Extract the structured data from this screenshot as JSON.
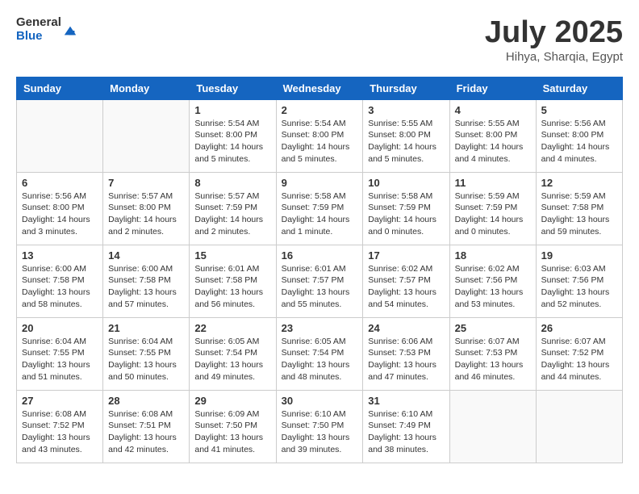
{
  "header": {
    "logo_general": "General",
    "logo_blue": "Blue",
    "month_title": "July 2025",
    "location": "Hihya, Sharqia, Egypt"
  },
  "days_of_week": [
    "Sunday",
    "Monday",
    "Tuesday",
    "Wednesday",
    "Thursday",
    "Friday",
    "Saturday"
  ],
  "weeks": [
    [
      {
        "num": "",
        "info": ""
      },
      {
        "num": "",
        "info": ""
      },
      {
        "num": "1",
        "info": "Sunrise: 5:54 AM\nSunset: 8:00 PM\nDaylight: 14 hours and 5 minutes."
      },
      {
        "num": "2",
        "info": "Sunrise: 5:54 AM\nSunset: 8:00 PM\nDaylight: 14 hours and 5 minutes."
      },
      {
        "num": "3",
        "info": "Sunrise: 5:55 AM\nSunset: 8:00 PM\nDaylight: 14 hours and 5 minutes."
      },
      {
        "num": "4",
        "info": "Sunrise: 5:55 AM\nSunset: 8:00 PM\nDaylight: 14 hours and 4 minutes."
      },
      {
        "num": "5",
        "info": "Sunrise: 5:56 AM\nSunset: 8:00 PM\nDaylight: 14 hours and 4 minutes."
      }
    ],
    [
      {
        "num": "6",
        "info": "Sunrise: 5:56 AM\nSunset: 8:00 PM\nDaylight: 14 hours and 3 minutes."
      },
      {
        "num": "7",
        "info": "Sunrise: 5:57 AM\nSunset: 8:00 PM\nDaylight: 14 hours and 2 minutes."
      },
      {
        "num": "8",
        "info": "Sunrise: 5:57 AM\nSunset: 7:59 PM\nDaylight: 14 hours and 2 minutes."
      },
      {
        "num": "9",
        "info": "Sunrise: 5:58 AM\nSunset: 7:59 PM\nDaylight: 14 hours and 1 minute."
      },
      {
        "num": "10",
        "info": "Sunrise: 5:58 AM\nSunset: 7:59 PM\nDaylight: 14 hours and 0 minutes."
      },
      {
        "num": "11",
        "info": "Sunrise: 5:59 AM\nSunset: 7:59 PM\nDaylight: 14 hours and 0 minutes."
      },
      {
        "num": "12",
        "info": "Sunrise: 5:59 AM\nSunset: 7:58 PM\nDaylight: 13 hours and 59 minutes."
      }
    ],
    [
      {
        "num": "13",
        "info": "Sunrise: 6:00 AM\nSunset: 7:58 PM\nDaylight: 13 hours and 58 minutes."
      },
      {
        "num": "14",
        "info": "Sunrise: 6:00 AM\nSunset: 7:58 PM\nDaylight: 13 hours and 57 minutes."
      },
      {
        "num": "15",
        "info": "Sunrise: 6:01 AM\nSunset: 7:58 PM\nDaylight: 13 hours and 56 minutes."
      },
      {
        "num": "16",
        "info": "Sunrise: 6:01 AM\nSunset: 7:57 PM\nDaylight: 13 hours and 55 minutes."
      },
      {
        "num": "17",
        "info": "Sunrise: 6:02 AM\nSunset: 7:57 PM\nDaylight: 13 hours and 54 minutes."
      },
      {
        "num": "18",
        "info": "Sunrise: 6:02 AM\nSunset: 7:56 PM\nDaylight: 13 hours and 53 minutes."
      },
      {
        "num": "19",
        "info": "Sunrise: 6:03 AM\nSunset: 7:56 PM\nDaylight: 13 hours and 52 minutes."
      }
    ],
    [
      {
        "num": "20",
        "info": "Sunrise: 6:04 AM\nSunset: 7:55 PM\nDaylight: 13 hours and 51 minutes."
      },
      {
        "num": "21",
        "info": "Sunrise: 6:04 AM\nSunset: 7:55 PM\nDaylight: 13 hours and 50 minutes."
      },
      {
        "num": "22",
        "info": "Sunrise: 6:05 AM\nSunset: 7:54 PM\nDaylight: 13 hours and 49 minutes."
      },
      {
        "num": "23",
        "info": "Sunrise: 6:05 AM\nSunset: 7:54 PM\nDaylight: 13 hours and 48 minutes."
      },
      {
        "num": "24",
        "info": "Sunrise: 6:06 AM\nSunset: 7:53 PM\nDaylight: 13 hours and 47 minutes."
      },
      {
        "num": "25",
        "info": "Sunrise: 6:07 AM\nSunset: 7:53 PM\nDaylight: 13 hours and 46 minutes."
      },
      {
        "num": "26",
        "info": "Sunrise: 6:07 AM\nSunset: 7:52 PM\nDaylight: 13 hours and 44 minutes."
      }
    ],
    [
      {
        "num": "27",
        "info": "Sunrise: 6:08 AM\nSunset: 7:52 PM\nDaylight: 13 hours and 43 minutes."
      },
      {
        "num": "28",
        "info": "Sunrise: 6:08 AM\nSunset: 7:51 PM\nDaylight: 13 hours and 42 minutes."
      },
      {
        "num": "29",
        "info": "Sunrise: 6:09 AM\nSunset: 7:50 PM\nDaylight: 13 hours and 41 minutes."
      },
      {
        "num": "30",
        "info": "Sunrise: 6:10 AM\nSunset: 7:50 PM\nDaylight: 13 hours and 39 minutes."
      },
      {
        "num": "31",
        "info": "Sunrise: 6:10 AM\nSunset: 7:49 PM\nDaylight: 13 hours and 38 minutes."
      },
      {
        "num": "",
        "info": ""
      },
      {
        "num": "",
        "info": ""
      }
    ]
  ]
}
